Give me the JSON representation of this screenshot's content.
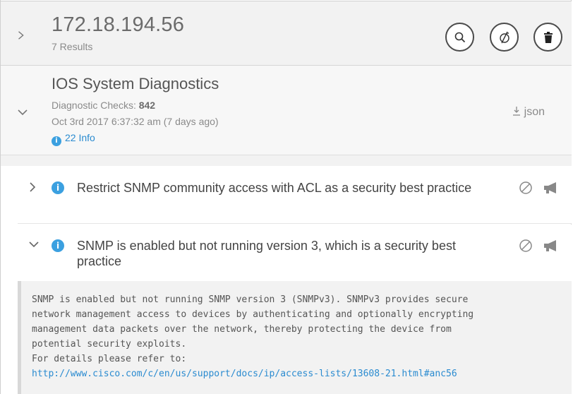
{
  "header": {
    "title": "172.18.194.56",
    "results": "7 Results"
  },
  "section": {
    "title": "IOS System Diagnostics",
    "checks_label": "Diagnostic Checks: ",
    "checks_count": "842",
    "timestamp": "Oct 3rd 2017 6:37:32 am (7 days ago)",
    "info_count": "22 Info",
    "json_label": "json"
  },
  "items": [
    {
      "text": "Restrict SNMP community access with ACL as a security best practice"
    },
    {
      "text": "SNMP is enabled but not running version 3, which is a security best practice"
    }
  ],
  "detail": {
    "lines": [
      "SNMP is enabled but not running SNMP version 3 (SNMPv3). SNMPv3 provides secure",
      "network management access to devices by authenticating and optionally encrypting",
      "management data packets over the network, thereby protecting the device from",
      "potential security exploits.",
      "For details please refer to:"
    ],
    "link": "http://www.cisco.com/c/en/us/support/docs/ip/access-lists/13608-21.html#anc56"
  },
  "colors": {
    "accent": "#3ba0e0",
    "link": "#2a8bd0",
    "header_bg": "#f2f2f2"
  },
  "icons": {
    "header_buttons": [
      "search-icon",
      "no-monitor-icon",
      "trash-icon"
    ],
    "item_actions": [
      "ignore-icon",
      "announce-icon"
    ]
  }
}
